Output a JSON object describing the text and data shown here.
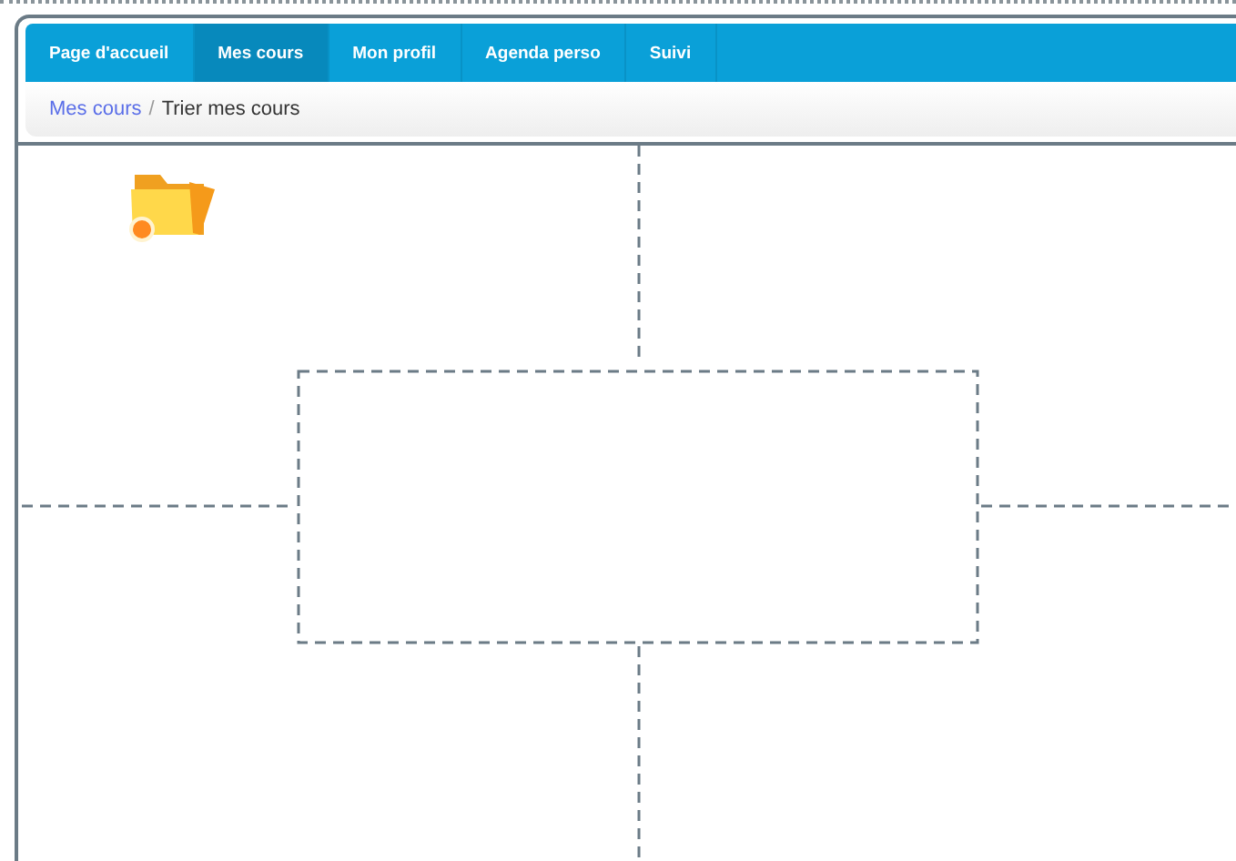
{
  "nav": {
    "tabs": [
      {
        "label": "Page d'accueil",
        "selected": false
      },
      {
        "label": "Mes cours",
        "selected": true
      },
      {
        "label": "Mon profil",
        "selected": false
      },
      {
        "label": "Agenda perso",
        "selected": false
      },
      {
        "label": "Suivi",
        "selected": false
      }
    ]
  },
  "breadcrumb": {
    "link": "Mes cours",
    "separator": "/",
    "current": "Trier mes cours"
  }
}
